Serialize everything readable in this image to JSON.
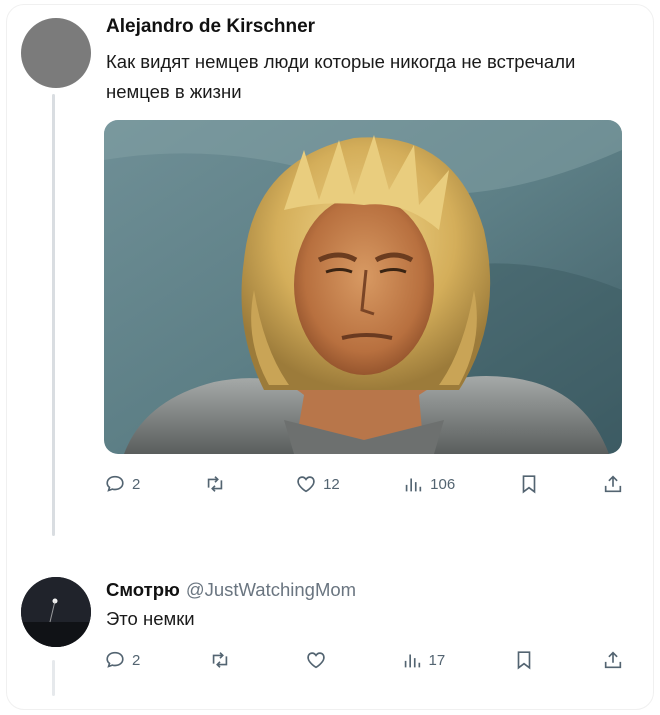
{
  "tweet": {
    "author_name": "Alejandro de Kirschner",
    "text": "Как видят немцев люди которые никогда не встречали немцев в жизни",
    "image_icon": "photo-of-man-with-blond-hair-in-armor",
    "stats": {
      "replies": "2",
      "retweets": "",
      "likes": "12",
      "views": "106"
    }
  },
  "reply": {
    "author_name": "Смотрю",
    "handle": "@JustWatchingMom",
    "text": "Это немки",
    "stats": {
      "replies": "2",
      "retweets": "",
      "likes": "",
      "views": "17"
    }
  },
  "colors": {
    "icon_gray": "#536471",
    "thread_line": "#d9dde1"
  }
}
